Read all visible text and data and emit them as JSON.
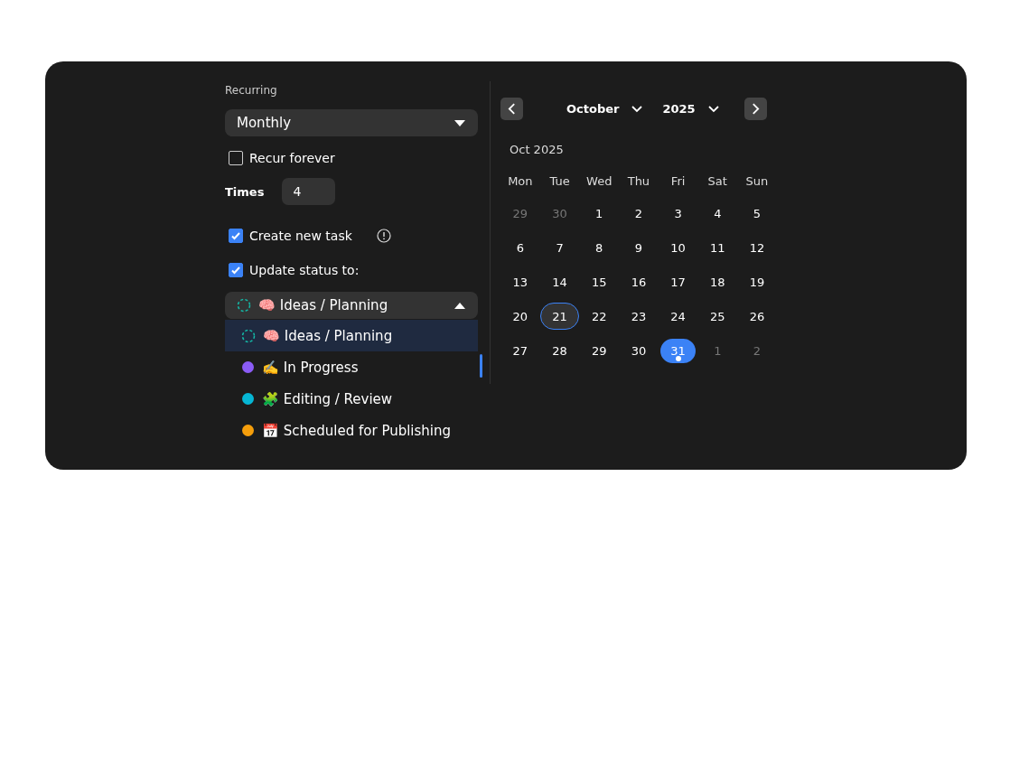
{
  "recurring": {
    "label": "Recurring",
    "value": "Monthly"
  },
  "recur_forever": {
    "label": "Recur forever",
    "checked": false
  },
  "times": {
    "label": "Times",
    "value": "4"
  },
  "create_new_task": {
    "label": "Create new task",
    "checked": true
  },
  "update_status": {
    "label": "Update status to:",
    "checked": true
  },
  "status_select": {
    "value": "🧠 Ideas / Planning",
    "kind": "pending",
    "expanded": true
  },
  "status_options": [
    {
      "label": "🧠 Ideas / Planning",
      "kind": "pending",
      "selected": true
    },
    {
      "label": "✍️ In Progress",
      "kind": "dot",
      "color": "#8b5cf6",
      "selected": false
    },
    {
      "label": "🧩 Editing / Review",
      "kind": "dot",
      "color": "#06b6d4",
      "selected": false
    },
    {
      "label": "📅 Scheduled for Publishing",
      "kind": "dot",
      "color": "#f59e0b",
      "selected": false
    }
  ],
  "calendar": {
    "month": "October",
    "year": "2025",
    "caption": "Oct 2025",
    "weekdays": [
      "Mon",
      "Tue",
      "Wed",
      "Thu",
      "Fri",
      "Sat",
      "Sun"
    ],
    "days": [
      {
        "label": "29",
        "outside": true,
        "today": false,
        "selected": false
      },
      {
        "label": "30",
        "outside": true,
        "today": false,
        "selected": false
      },
      {
        "label": "1",
        "outside": false,
        "today": false,
        "selected": false
      },
      {
        "label": "2",
        "outside": false,
        "today": false,
        "selected": false
      },
      {
        "label": "3",
        "outside": false,
        "today": false,
        "selected": false
      },
      {
        "label": "4",
        "outside": false,
        "today": false,
        "selected": false
      },
      {
        "label": "5",
        "outside": false,
        "today": false,
        "selected": false
      },
      {
        "label": "6",
        "outside": false,
        "today": false,
        "selected": false
      },
      {
        "label": "7",
        "outside": false,
        "today": false,
        "selected": false
      },
      {
        "label": "8",
        "outside": false,
        "today": false,
        "selected": false
      },
      {
        "label": "9",
        "outside": false,
        "today": false,
        "selected": false
      },
      {
        "label": "10",
        "outside": false,
        "today": false,
        "selected": false
      },
      {
        "label": "11",
        "outside": false,
        "today": false,
        "selected": false
      },
      {
        "label": "12",
        "outside": false,
        "today": false,
        "selected": false
      },
      {
        "label": "13",
        "outside": false,
        "today": false,
        "selected": false
      },
      {
        "label": "14",
        "outside": false,
        "today": false,
        "selected": false
      },
      {
        "label": "15",
        "outside": false,
        "today": false,
        "selected": false
      },
      {
        "label": "16",
        "outside": false,
        "today": false,
        "selected": false
      },
      {
        "label": "17",
        "outside": false,
        "today": false,
        "selected": false
      },
      {
        "label": "18",
        "outside": false,
        "today": false,
        "selected": false
      },
      {
        "label": "19",
        "outside": false,
        "today": false,
        "selected": false
      },
      {
        "label": "20",
        "outside": false,
        "today": false,
        "selected": false
      },
      {
        "label": "21",
        "outside": false,
        "today": true,
        "selected": false
      },
      {
        "label": "22",
        "outside": false,
        "today": false,
        "selected": false
      },
      {
        "label": "23",
        "outside": false,
        "today": false,
        "selected": false
      },
      {
        "label": "24",
        "outside": false,
        "today": false,
        "selected": false
      },
      {
        "label": "25",
        "outside": false,
        "today": false,
        "selected": false
      },
      {
        "label": "26",
        "outside": false,
        "today": false,
        "selected": false
      },
      {
        "label": "27",
        "outside": false,
        "today": false,
        "selected": false
      },
      {
        "label": "28",
        "outside": false,
        "today": false,
        "selected": false
      },
      {
        "label": "29",
        "outside": false,
        "today": false,
        "selected": false
      },
      {
        "label": "30",
        "outside": false,
        "today": false,
        "selected": false
      },
      {
        "label": "31",
        "outside": false,
        "today": false,
        "selected": true
      },
      {
        "label": "1",
        "outside": true,
        "today": false,
        "selected": false
      },
      {
        "label": "2",
        "outside": true,
        "today": false,
        "selected": false
      }
    ]
  }
}
